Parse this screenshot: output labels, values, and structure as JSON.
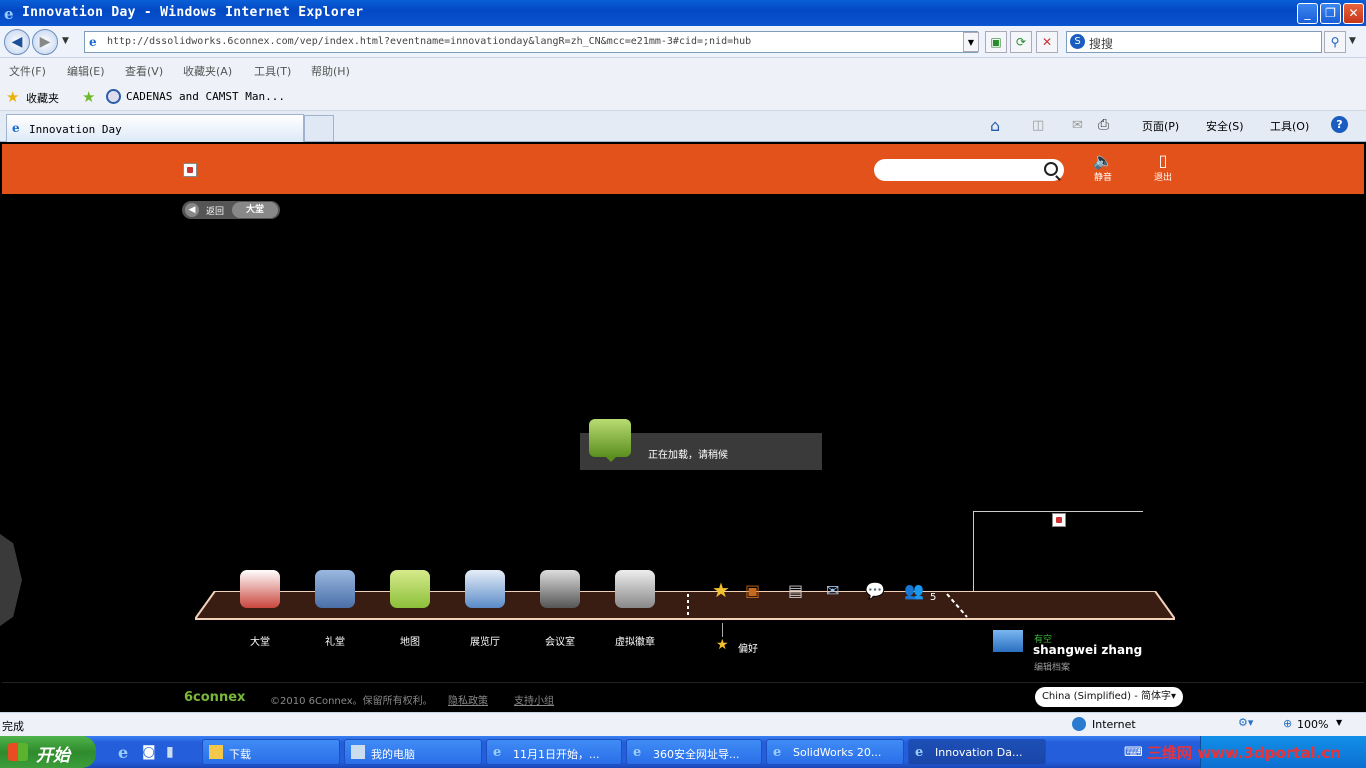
{
  "window": {
    "title": "Innovation Day - Windows Internet Explorer",
    "minimize": "_",
    "restore": "❐",
    "close": "✕"
  },
  "address_bar": {
    "url": "http://dssolidworks.6connex.com/vep/index.html?eventname=innovationday&langR=zh_CN&mcc=e21mm-3#cid=;nid=hub",
    "search_placeholder": "搜搜"
  },
  "menu": {
    "items": [
      "文件(F)",
      "编辑(E)",
      "查看(V)",
      "收藏夹(A)",
      "工具(T)",
      "帮助(H)"
    ]
  },
  "favorites": {
    "label": "收藏夹",
    "items": [
      "CADENAS and CAMST Man..."
    ]
  },
  "tabs": {
    "active": "Innovation Day"
  },
  "command_bar": {
    "page": "页面(P)",
    "safety": "安全(S)",
    "tools": "工具(O)"
  },
  "site": {
    "header": {
      "mute_label": "静音",
      "logout_label": "退出"
    },
    "breadcrumb": {
      "back": "返回",
      "current": "大堂"
    },
    "loading": {
      "text": "正在加载，请稍候"
    },
    "nav": {
      "items": [
        {
          "label": "大堂",
          "color": "#c9463d"
        },
        {
          "label": "礼堂",
          "color": "#4a6fa8"
        },
        {
          "label": "地图",
          "color": "#8cbf3a"
        },
        {
          "label": "展览厅",
          "color": "#5a8bc8"
        },
        {
          "label": "会议室",
          "color": "#555555"
        },
        {
          "label": "虚拟徽章",
          "color": "#888888"
        }
      ],
      "favorites_label": "偏好",
      "badge_count": "5"
    },
    "user": {
      "status": "有空",
      "name": "shangwei zhang",
      "edit": "编辑档案"
    },
    "footer": {
      "logo": "6connex",
      "copyright": "©2010 6Connex。保留所有权利。",
      "privacy": "隐私政策",
      "support": "支持小组",
      "language": "China (Simplified) - 简体字▾"
    }
  },
  "status_bar": {
    "text": "完成",
    "zone": "Internet",
    "zoom": "100%"
  },
  "taskbar": {
    "start": "开始",
    "items": [
      "下载",
      "我的电脑",
      "11月1日开始，...",
      "360安全网址导...",
      "SolidWorks 20...",
      "Innovation Da..."
    ],
    "tray_watermark": "三维网 www.3dportal.cn"
  },
  "colors": {
    "site_accent": "#e4521b",
    "taskbar": "#245edb",
    "start_green": "#3c9d3a"
  }
}
